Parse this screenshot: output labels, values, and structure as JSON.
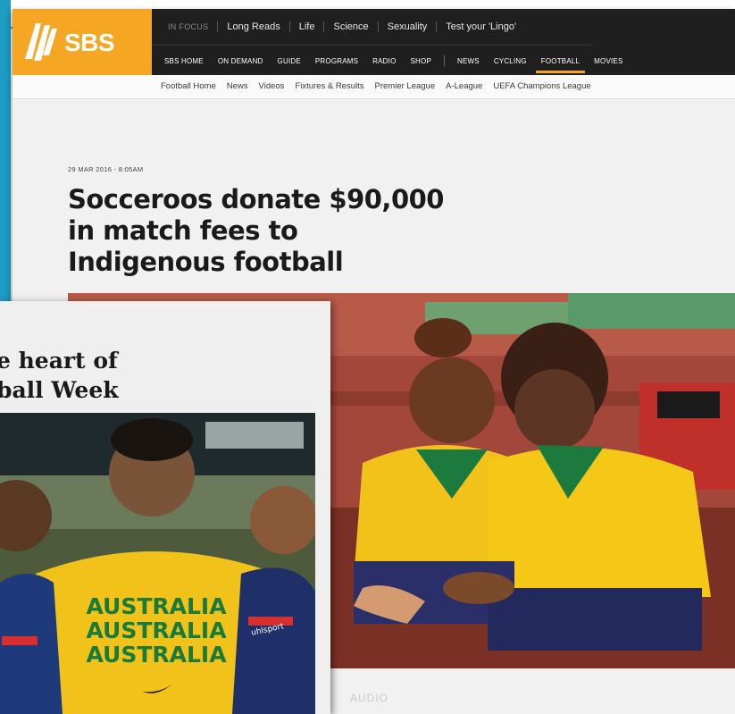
{
  "site": {
    "logo_text": "SBS"
  },
  "nav_top": [
    "IN FOCUS",
    "Long Reads",
    "Life",
    "Science",
    "Sexuality",
    "Test your 'Lingo'"
  ],
  "nav_sub_left": [
    "SBS HOME",
    "ON DEMAND",
    "GUIDE",
    "PROGRAMS",
    "RADIO",
    "SHOP"
  ],
  "nav_sub_right": [
    "NEWS",
    "CYCLING",
    "FOOTBALL",
    "MOVIES"
  ],
  "nav_sub_active": "FOOTBALL",
  "football_nav": [
    "Football Home",
    "News",
    "Videos",
    "Fixtures & Results",
    "Premier League",
    "A-League",
    "UEFA Champions League"
  ],
  "article": {
    "dateline": "29 MAR 2016 - 8:05AM",
    "headline_lines": [
      "Socceroos donate $90,000",
      "in match fees to",
      "Indigenous football"
    ],
    "audio_label": "AUDIO"
  },
  "overlay_article": {
    "heading_lines": [
      "e heart of",
      "ball Week"
    ],
    "shirt_text": [
      "AUSTRALIA",
      "AUSTRALIA",
      "AUSTRALIA"
    ],
    "sleeve_brand": "uhlsport"
  },
  "colors": {
    "brand_orange": "#f5a623",
    "nav_dark": "#1f1f1f",
    "teal_accent": "#1d9cc4"
  },
  "icons": [
    "sbs-logo-icon",
    "nike-swoosh-icon"
  ]
}
